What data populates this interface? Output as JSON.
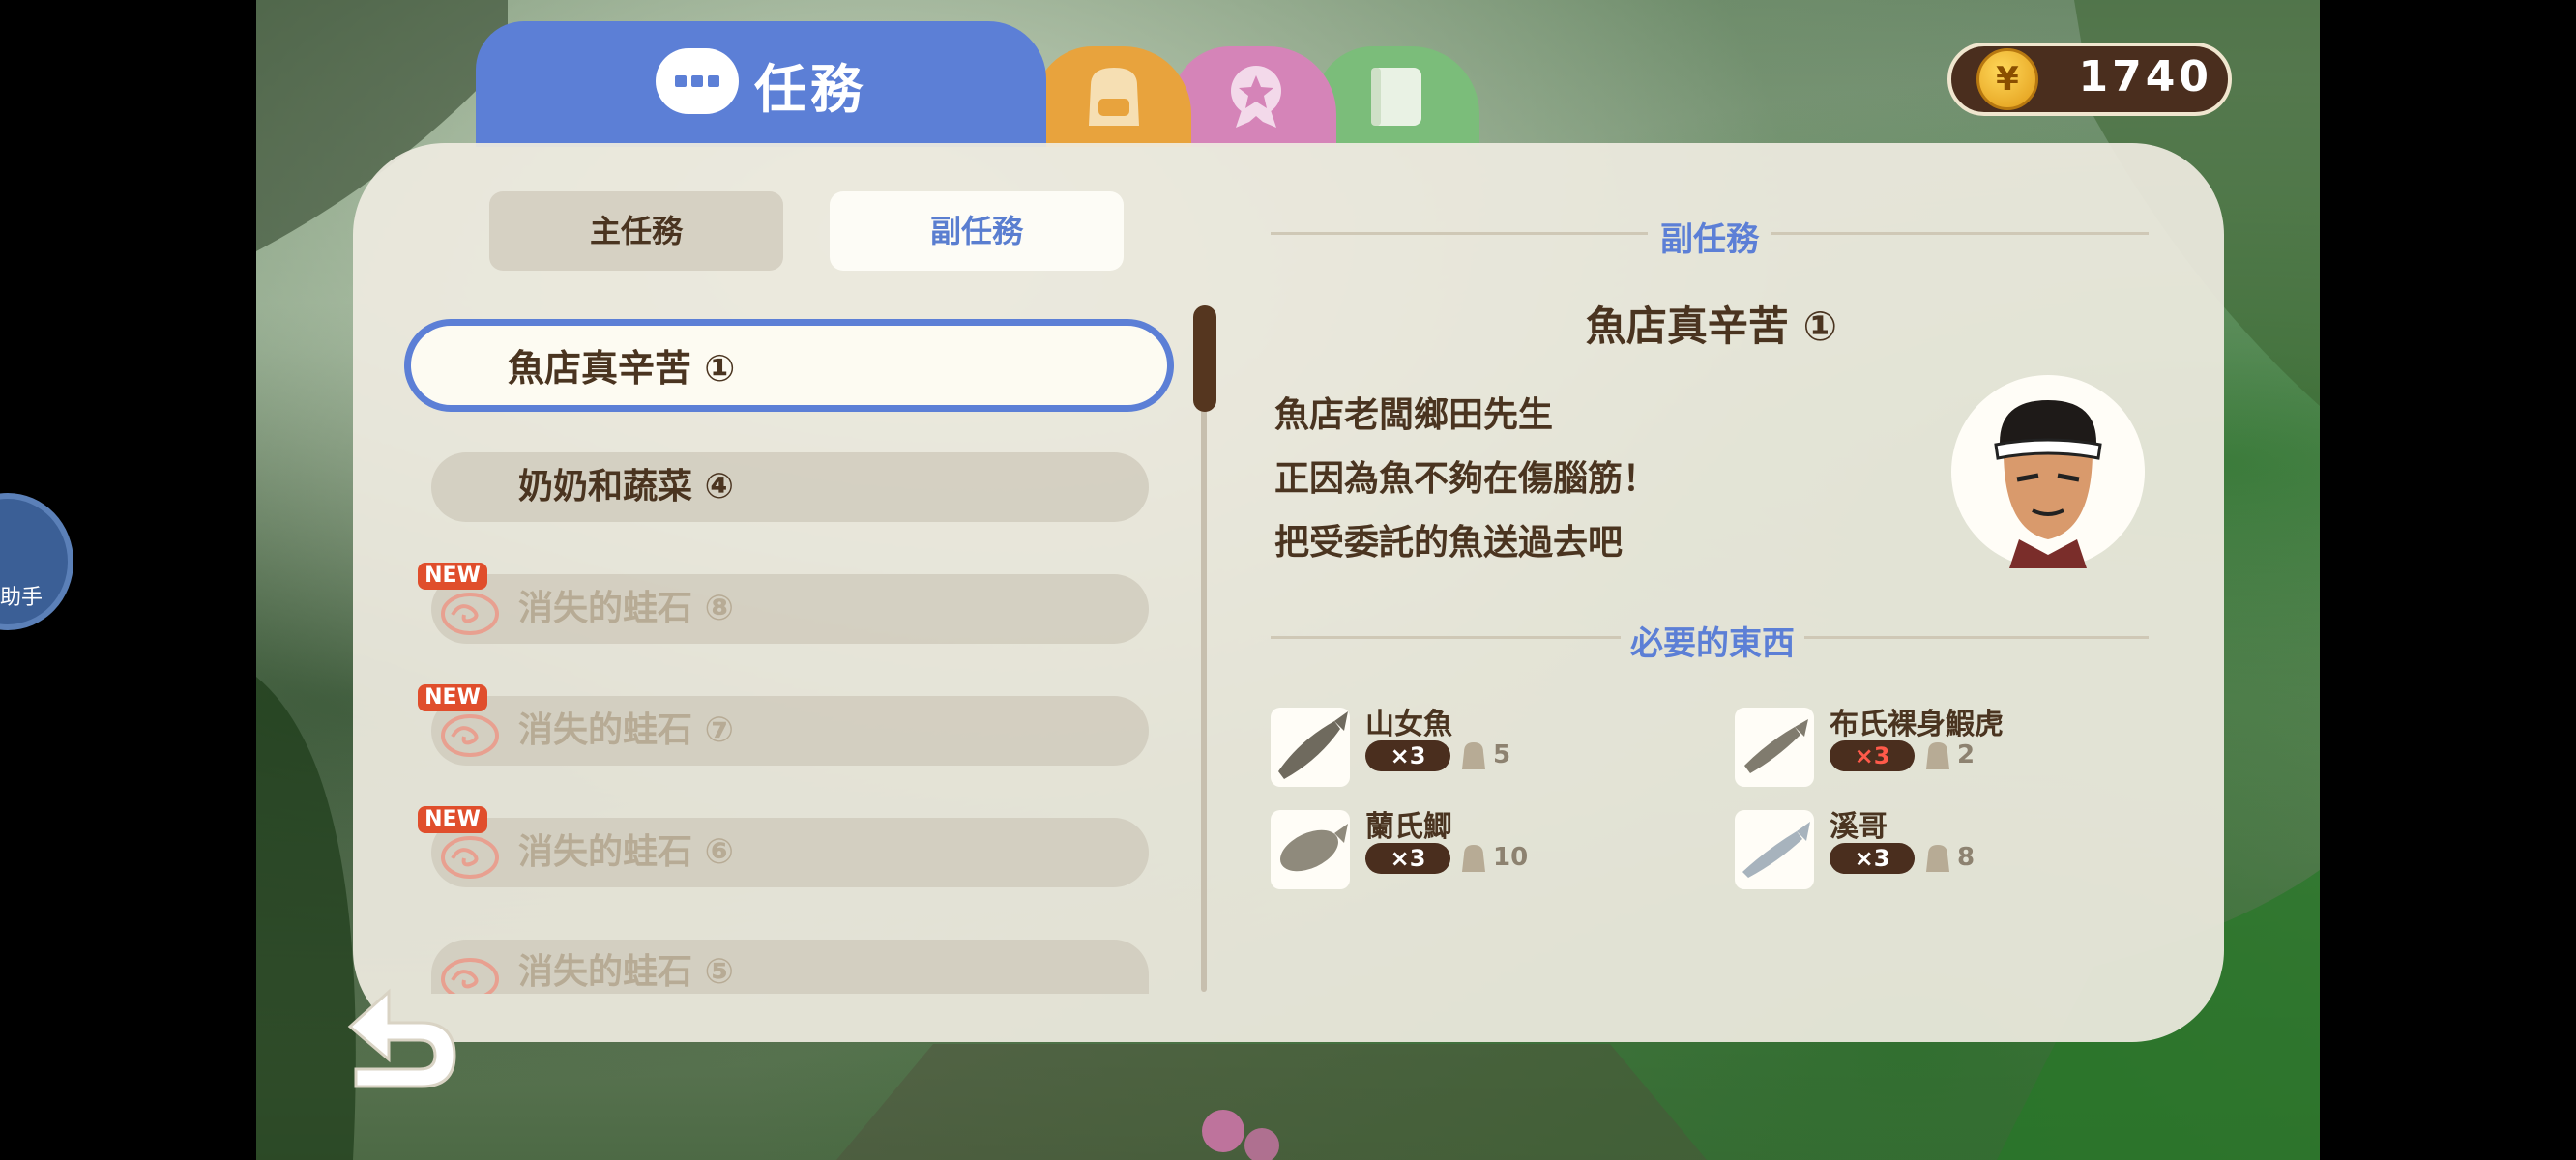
{
  "currency": {
    "amount": "1740",
    "icon": "yen-coin-icon",
    "symbol": "¥"
  },
  "helper": {
    "label": "助手"
  },
  "tabs": {
    "active_title": "任務",
    "others": [
      "backpack-icon",
      "award-badge-icon",
      "book-icon"
    ]
  },
  "subtabs": {
    "main": "主任務",
    "side": "副任務"
  },
  "quests": [
    {
      "label": "魚店真辛苦 ①",
      "selected": true,
      "new": false
    },
    {
      "label": "奶奶和蔬菜 ④",
      "selected": false,
      "new": false
    },
    {
      "label": "消失的蛙石 ⑧",
      "selected": false,
      "new": true
    },
    {
      "label": "消失的蛙石 ⑦",
      "selected": false,
      "new": true
    },
    {
      "label": "消失的蛙石 ⑥",
      "selected": false,
      "new": true
    },
    {
      "label": "消失的蛙石 ⑤",
      "selected": false,
      "new": false
    }
  ],
  "new_badge": "NEW",
  "detail": {
    "section": "副任務",
    "title": "魚店真辛苦 ①",
    "lines": [
      "魚店老闆鄉田先生",
      "正因為魚不夠在傷腦筋！",
      "把受委託的魚送過去吧"
    ],
    "required_header": "必要的東西",
    "items": [
      {
        "name": "山女魚",
        "need": "×3",
        "have": "5",
        "short": false
      },
      {
        "name": "布氏裸身鰕虎",
        "need": "×3",
        "have": "2",
        "short": true
      },
      {
        "name": "蘭氏鯽",
        "need": "×3",
        "have": "10",
        "short": false
      },
      {
        "name": "溪哥",
        "need": "×3",
        "have": "8",
        "short": false
      }
    ]
  },
  "colors": {
    "accent_blue": "#5c7fd6",
    "brown": "#4a3420",
    "panel": "#eeebe0"
  }
}
